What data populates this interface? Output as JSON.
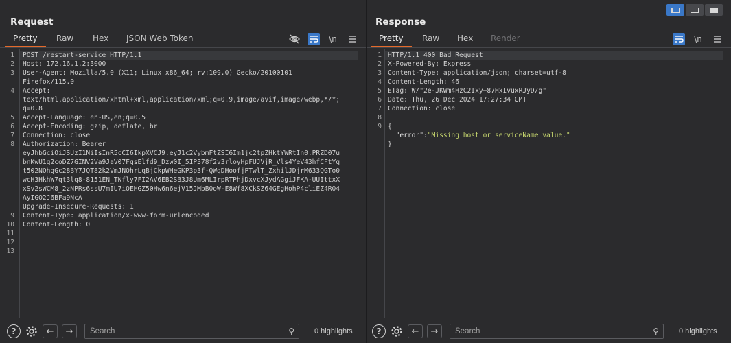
{
  "layout_switcher": {
    "options": [
      "side-by-side",
      "stacked",
      "single"
    ],
    "active": "side-by-side"
  },
  "request": {
    "title": "Request",
    "tabs": [
      {
        "label": "Pretty",
        "active": true
      },
      {
        "label": "Raw"
      },
      {
        "label": "Hex"
      },
      {
        "label": "JSON Web Token"
      }
    ],
    "tool_icons": [
      "eye-off-icon",
      "wrap-icon",
      "newline-icon",
      "menu-icon"
    ],
    "newline_label": "\\n",
    "line_numbers": [
      "1",
      "2",
      "3",
      "",
      "4",
      "",
      "",
      "5",
      "6",
      "7",
      "8",
      "",
      "",
      "",
      "",
      "",
      "",
      "",
      "9",
      "10",
      "11",
      "12",
      "13"
    ],
    "lines": [
      "POST /restart-service HTTP/1.1",
      "Host: 172.16.1.2:3000",
      "User-Agent: Mozilla/5.0 (X11; Linux x86_64; rv:109.0) Gecko/20100101",
      "Firefox/115.0",
      "Accept:",
      "text/html,application/xhtml+xml,application/xml;q=0.9,image/avif,image/webp,*/*;",
      "q=0.8",
      "Accept-Language: en-US,en;q=0.5",
      "Accept-Encoding: gzip, deflate, br",
      "Connection: close",
      "Authorization: Bearer",
      "eyJhbGciOiJSUzI1NiIsInR5cCI6IkpXVCJ9.eyJ1c2VybmFtZSI6Im1jc2tpZHktYWRtIn0.PRZD07u",
      "bnKwU1q2coDZ7GINV2Va9JaV07FqsElfd9_Dzw0I_5IP378f2v3rloyHpFUJVjR_Vls4YeV43hfCFtYq",
      "t502NOhgGc28BY7JQT82k2VmJNOhrLqBjCkpWHeGKP3p3f-QWgDHoofjPTwlT_ZxhilJDjrM633QGTo0",
      "wcH3HkhW7qt3lq8-8151EN_TNfly7FI2AV6EB2SB3J8Um6MLIrpRTPhjDxvcXJydAGgiJFKA-UUIttxX",
      "xSv2sWCM8_2zNPRs6ssU7mIU7iOEHGZ50Hw6n6ejV15JMbB0oW-E8Wf8XCkSZ64GEgHohP4cliEZ4R04",
      "AyIGO2J6BFa9NcA",
      "Upgrade-Insecure-Requests: 1",
      "Content-Type: application/x-www-form-urlencoded",
      "Content-Length: 0",
      "",
      ""
    ],
    "footer": {
      "search_placeholder": "Search",
      "highlights": "0 highlights"
    }
  },
  "response": {
    "title": "Response",
    "tabs": [
      {
        "label": "Pretty",
        "active": true
      },
      {
        "label": "Raw"
      },
      {
        "label": "Hex"
      },
      {
        "label": "Render",
        "disabled": true
      }
    ],
    "tool_icons": [
      "wrap-icon",
      "newline-icon",
      "menu-icon"
    ],
    "newline_label": "\\n",
    "line_numbers": [
      "1",
      "2",
      "3",
      "4",
      "5",
      "6",
      "7",
      "8",
      "9",
      "",
      "",
      ""
    ],
    "lines": [
      "HTTP/1.1 400 Bad Request",
      "X-Powered-By: Express",
      "Content-Type: application/json; charset=utf-8",
      "Content-Length: 46",
      "ETag: W/\"2e-JKWm4HzC2Ixy+87HxIvuxRJyD/g\"",
      "Date: Thu, 26 Dec 2024 17:27:34 GMT",
      "Connection: close",
      "",
      "{",
      "  \"error\":\"Missing host or serviceName value.\"",
      "}"
    ],
    "json_body": {
      "key": "\"error\":",
      "value": "\"Missing host or serviceName value.\""
    },
    "footer": {
      "search_placeholder": "Search",
      "highlights": "0 highlights"
    }
  }
}
